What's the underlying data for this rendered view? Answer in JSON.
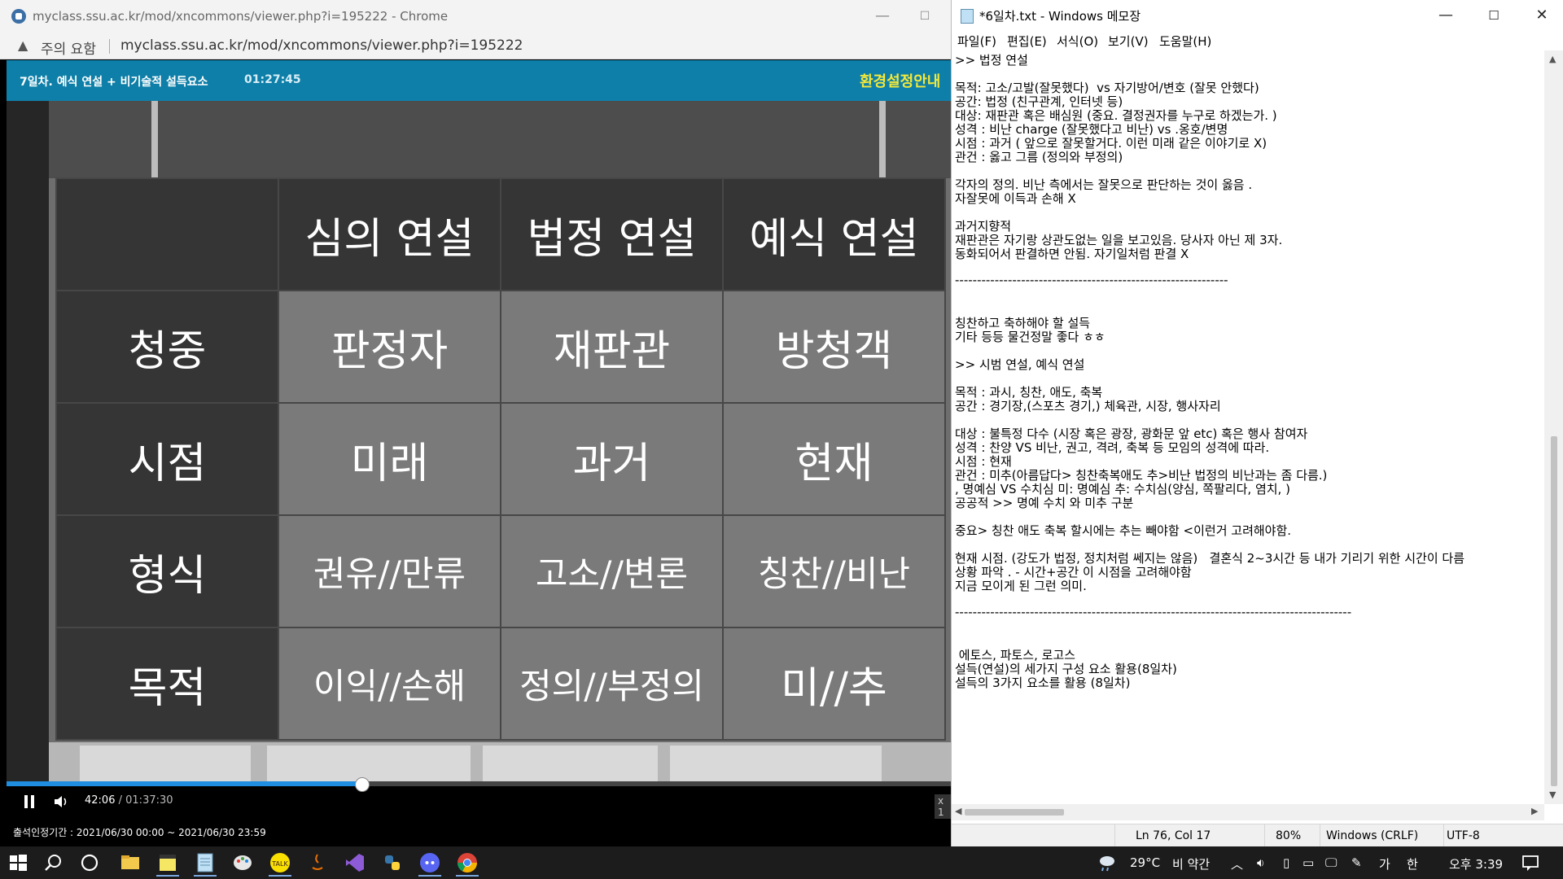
{
  "chrome": {
    "title": "myclass.ssu.ac.kr/mod/xncommons/viewer.php?i=195222 - Chrome",
    "security_label": "주의 요함",
    "url": "myclass.ssu.ac.kr/mod/xncommons/viewer.php?i=195222",
    "lecture_title": "7일차. 예식 연설 + 비기술적 설득요소",
    "lecture_time": "01:27:45",
    "settings_label": "환경설정안내"
  },
  "slide": {
    "headers": [
      "",
      "심의 연설",
      "법정 연설",
      "예식 연설"
    ],
    "rows": [
      {
        "label": "청중",
        "cells": [
          "판정자",
          "재판관",
          "방청객"
        ]
      },
      {
        "label": "시점",
        "cells": [
          "미래",
          "과거",
          "현재"
        ]
      },
      {
        "label": "형식",
        "cells": [
          "권유//만류",
          "고소//변론",
          "칭찬//비난"
        ]
      },
      {
        "label": "목적",
        "cells": [
          "이익//손해",
          "정의//부정의",
          "미//추"
        ]
      }
    ]
  },
  "player": {
    "current_time": "42:06",
    "separator": "/",
    "total_time": "01:37:30",
    "progress_fraction": 0.3757,
    "speed_label": "x 1",
    "attendance": "출석인정기간 : 2021/06/30 00:00 ~ 2021/06/30 23:59"
  },
  "notepad": {
    "title": "*6일차.txt - Windows 메모장",
    "menu": [
      "파일(F)",
      "편집(E)",
      "서식(O)",
      "보기(V)",
      "도움말(H)"
    ],
    "lines": [
      ">> 법정 연설",
      "",
      "목적: 고소/고발(잘못했다)  vs 자기방어/변호 (잘못 안했다)",
      "공간: 법정 (친구관계, 인터넷 등)",
      "대상: 재판관 혹은 배심원 (중요. 결정권자를 누구로 하겠는가. )",
      "성격 : 비난 charge (잘못했다고 비난) vs .옹호/변명",
      "시점 : 과거 ( 앞으로 잘못할거다. 이런 미래 같은 이야기로 X)",
      "관건 : 옳고 그름 (정의와 부정의)",
      "",
      "각자의 정의. 비난 측에서는 잘못으로 판단하는 것이 옳음 .",
      "자잘못에 이득과 손해 X",
      "",
      "과거지향적",
      "재판관은 자기랑 상관도없는 일을 보고있음. 당사자 아닌 제 3자.",
      "동화되어서 판결하면 안됨. 자기일처럼 판결 X",
      "",
      "--------------------------------------------------------------",
      "",
      "",
      "칭찬하고 축하해야 할 설득",
      "기타 등등 물건정말 좋다 ㅎㅎ",
      "",
      ">> 시범 연설, 예식 연설",
      "",
      "목적 : 과시, 칭찬, 애도, 축복",
      "공간 : 경기장,(스포츠 경기,) 체육관, 시장, 행사자리",
      "",
      "대상 : 불특정 다수 (시장 혹은 광장, 광화문 앞 etc) 혹은 행사 참여자",
      "성격 : 찬양 VS 비난, 권고, 격려, 축복 등 모임의 성격에 따라.",
      "시점 : 현재",
      "관건 : 미추(아름답다> 칭찬축복애도 추>비난 법정의 비난과는 좀 다름.)",
      ", 명예심 VS 수치심 미: 명예심 추: 수치심(양심, 쪽팔리다, 염치, )",
      "공공적 >> 명예 수치 와 미추 구분",
      "",
      "중요> 칭찬 애도 축복 할시에는 추는 빼야함 <이런거 고려해야함.",
      "",
      "현재 시점. (강도가 법정, 정치처럼 쎄지는 않음)   결혼식 2~3시간 등 내가 기리기 위한 시간이 다름",
      "상황 파악 . - 시간+공간 이 시점을 고려해야함",
      "지금 모이게 된 그런 의미.",
      "",
      "------------------------------------------------------------------------------------------",
      "",
      "",
      " 에토스, 파토스, 로고스",
      "설득(연설)의 세가지 구성 요소 활용(8일차)",
      "설득의 3가지 요소를 활용 (8일차)"
    ],
    "status": {
      "position": "Ln 76, Col 17",
      "zoom": "80%",
      "line_ending": "Windows (CRLF)",
      "encoding": "UTF-8"
    }
  },
  "taskbar": {
    "temperature": "29°C",
    "weather": "비 약간",
    "ime_mode": "가",
    "ime_hanja": "한",
    "clock": "오후 3:39"
  },
  "colors": {
    "lecture_bar": "#0e7fa8",
    "settings_text": "#f3e83a",
    "progress": "#1f8de0"
  }
}
